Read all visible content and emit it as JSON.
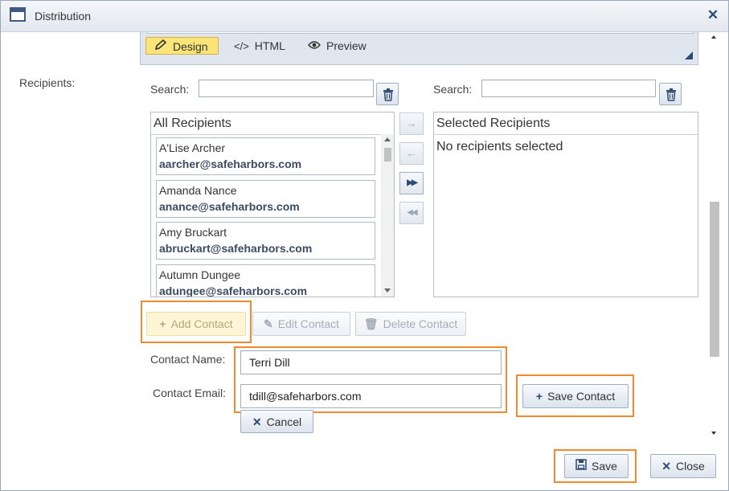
{
  "window": {
    "title": "Distribution",
    "close_glyph": "✕"
  },
  "editor": {
    "modes": [
      {
        "label": "Design",
        "icon": "pencil-icon",
        "active": true
      },
      {
        "label": "HTML",
        "icon": "code-icon",
        "active": false
      },
      {
        "label": "Preview",
        "icon": "eye-icon",
        "active": false
      }
    ]
  },
  "recipients": {
    "label": "Recipients:",
    "search_label": "Search:",
    "all": {
      "header": "All Recipients",
      "items": [
        {
          "name": "A'Lise Archer",
          "email": "aarcher@safeharbors.com"
        },
        {
          "name": "Amanda Nance",
          "email": "anance@safeharbors.com"
        },
        {
          "name": "Amy Bruckart",
          "email": "abruckart@safeharbors.com"
        },
        {
          "name": "Autumn Dungee",
          "email": "adungee@safeharbors.com"
        }
      ]
    },
    "selected": {
      "header": "Selected Recipients",
      "empty_text": "No recipients selected"
    },
    "move_buttons": [
      "→",
      "←",
      "▶▶",
      "◀◀"
    ]
  },
  "contact_actions": {
    "add": "Add Contact",
    "edit": "Edit Contact",
    "delete": "Delete Contact"
  },
  "contact_form": {
    "name_label": "Contact Name:",
    "name_value": "Terri Dill",
    "email_label": "Contact Email:",
    "email_value": "tdill@safeharbors.com",
    "save_contact": "Save Contact",
    "cancel": "Cancel"
  },
  "footer": {
    "save": "Save",
    "close": "Close"
  },
  "colors": {
    "highlight": "#f08a2e",
    "accent": "#2c4a72",
    "active_mode": "#fbe47a"
  }
}
